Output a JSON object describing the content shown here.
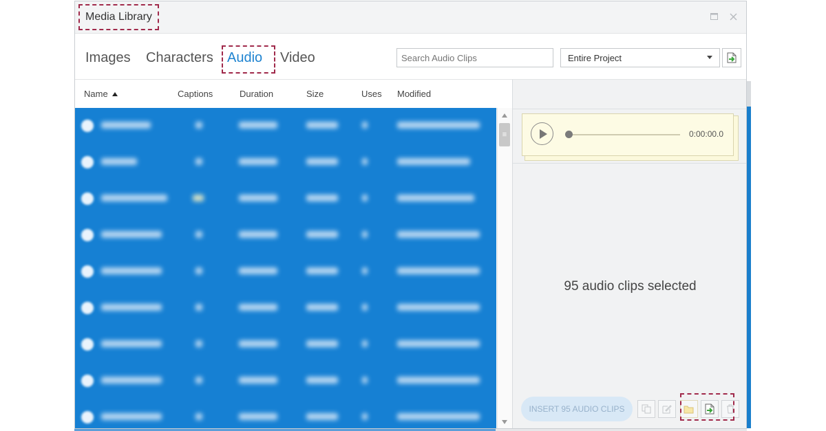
{
  "window": {
    "title": "Media Library"
  },
  "tabs": [
    {
      "label": "Images"
    },
    {
      "label": "Characters"
    },
    {
      "label": "Audio"
    },
    {
      "label": "Video"
    }
  ],
  "search": {
    "placeholder": "Search Audio Clips"
  },
  "scope": {
    "selected": "Entire Project"
  },
  "table": {
    "columns": [
      "Name",
      "Captions",
      "Duration",
      "Size",
      "Uses",
      "Modified"
    ],
    "sort_column": "Name",
    "row_count_visible": 9
  },
  "player": {
    "time": "0:00:00.0",
    "progress": 0
  },
  "selection": {
    "message": "95 audio clips selected",
    "insert_label": "INSERT 95 AUDIO CLIPS"
  },
  "colors": {
    "accent": "#1e83d0",
    "selection": "#1680d3",
    "highlight": "#a0294a",
    "player_card": "#fdfbe4"
  },
  "icons": {
    "maximize": "maximize-icon",
    "close": "close-icon",
    "import": "import-file-icon",
    "duplicate": "duplicate-icon",
    "edit": "edit-icon",
    "folder": "open-folder-icon",
    "export": "export-file-icon",
    "delete": "trash-icon"
  }
}
